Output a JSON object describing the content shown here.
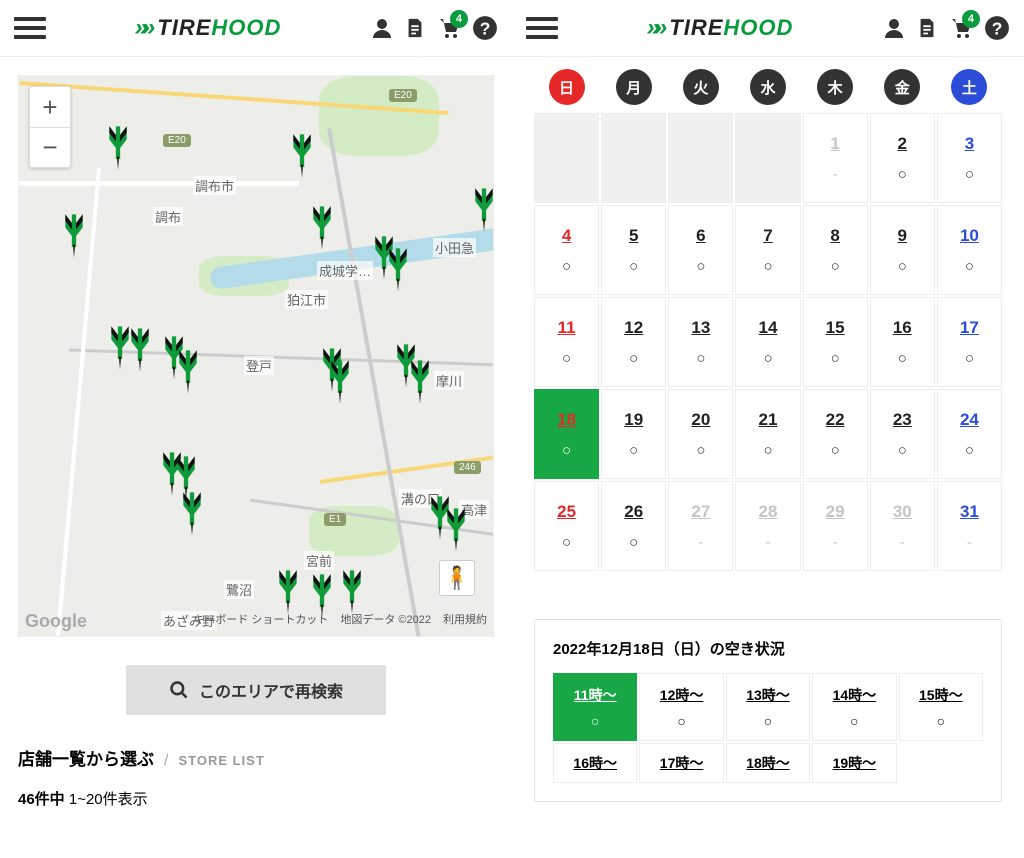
{
  "brand": {
    "chev": "»»",
    "left": "TIRE",
    "right": "HOOD",
    "cart_badge": "4"
  },
  "map": {
    "labels": {
      "chofu_shi": "調布市",
      "chofu": "調布",
      "seijogakuen": "成城学…",
      "komae": "狛江市",
      "noborito": "登戸",
      "mizonokuchi": "溝の口",
      "takatsu": "高津",
      "miyamae": "宮前",
      "saginuma": "鷺沼",
      "azamino": "あざみ野",
      "odakyu": "小田急",
      "r246": "246",
      "e20a": "E20",
      "e20b": "E20",
      "e1": "E1",
      "tama": "摩川"
    },
    "attr": {
      "google": "Google",
      "kb": "キーボード ショートカット",
      "data": "地図データ ©2022",
      "terms": "利用規約"
    },
    "pegman": "🧍"
  },
  "research_button": "このエリアで再検索",
  "store_list": {
    "jp": "店舗一覧から選ぶ",
    "en": "STORE LIST"
  },
  "count": {
    "total": "46件中",
    "range": "1~20件表示"
  },
  "dow": [
    "日",
    "月",
    "火",
    "水",
    "木",
    "金",
    "土"
  ],
  "calendar": [
    {
      "d": "",
      "k": "blank"
    },
    {
      "d": "",
      "k": "blank"
    },
    {
      "d": "",
      "k": "blank"
    },
    {
      "d": "",
      "k": "blank"
    },
    {
      "d": "1",
      "a": "-",
      "k": "disabled"
    },
    {
      "d": "2",
      "a": "○"
    },
    {
      "d": "3",
      "a": "○",
      "k": "sat"
    },
    {
      "d": "4",
      "a": "○",
      "k": "sun"
    },
    {
      "d": "5",
      "a": "○"
    },
    {
      "d": "6",
      "a": "○"
    },
    {
      "d": "7",
      "a": "○"
    },
    {
      "d": "8",
      "a": "○"
    },
    {
      "d": "9",
      "a": "○"
    },
    {
      "d": "10",
      "a": "○",
      "k": "sat"
    },
    {
      "d": "11",
      "a": "○",
      "k": "sun"
    },
    {
      "d": "12",
      "a": "○"
    },
    {
      "d": "13",
      "a": "○"
    },
    {
      "d": "14",
      "a": "○"
    },
    {
      "d": "15",
      "a": "○"
    },
    {
      "d": "16",
      "a": "○"
    },
    {
      "d": "17",
      "a": "○",
      "k": "sat"
    },
    {
      "d": "18",
      "a": "○",
      "k": "sun selected"
    },
    {
      "d": "19",
      "a": "○"
    },
    {
      "d": "20",
      "a": "○"
    },
    {
      "d": "21",
      "a": "○"
    },
    {
      "d": "22",
      "a": "○"
    },
    {
      "d": "23",
      "a": "○"
    },
    {
      "d": "24",
      "a": "○",
      "k": "sat"
    },
    {
      "d": "25",
      "a": "○",
      "k": "sun"
    },
    {
      "d": "26",
      "a": "○"
    },
    {
      "d": "27",
      "a": "-",
      "k": "disabled"
    },
    {
      "d": "28",
      "a": "-",
      "k": "disabled"
    },
    {
      "d": "29",
      "a": "-",
      "k": "disabled"
    },
    {
      "d": "30",
      "a": "-",
      "k": "disabled"
    },
    {
      "d": "31",
      "a": "-",
      "k": "disabled sat"
    }
  ],
  "slot_title": "2022年12月18日（日）の空き状況",
  "slots": [
    {
      "t": "11時～",
      "a": "○",
      "sel": true
    },
    {
      "t": "12時～",
      "a": "○"
    },
    {
      "t": "13時～",
      "a": "○"
    },
    {
      "t": "14時～",
      "a": "○"
    },
    {
      "t": "15時～",
      "a": "○"
    },
    {
      "t": "16時～",
      "a": ""
    },
    {
      "t": "17時～",
      "a": ""
    },
    {
      "t": "18時～",
      "a": ""
    },
    {
      "t": "19時～",
      "a": ""
    }
  ]
}
